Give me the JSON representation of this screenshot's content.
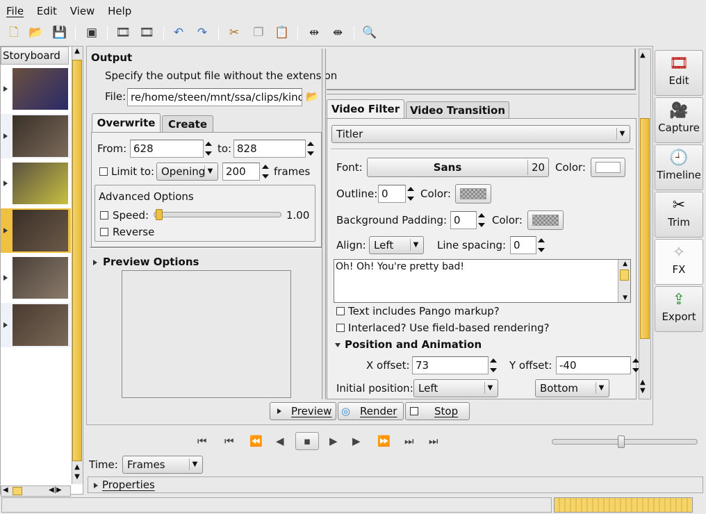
{
  "menu": [
    "File",
    "Edit",
    "View",
    "Help"
  ],
  "toolbar_icons": [
    "new-icon",
    "open-icon",
    "save-icon",
    "save-as-icon",
    "film-icon",
    "film-insert-icon",
    "undo-icon",
    "redo-icon",
    "cut-icon",
    "copy-icon",
    "paste-icon",
    "split-icon",
    "join-icon",
    "zoom-icon"
  ],
  "storyboard": {
    "title": "Storyboard",
    "items": 6,
    "selected": 3
  },
  "output": {
    "title": "Output",
    "description": "Specify the output file without the extension",
    "file_label": "File:",
    "file_value": "re/home/steen/mnt/ssa/clips/kino/",
    "tabs": [
      "Overwrite",
      "Create"
    ],
    "from_label": "From:",
    "from_value": "628",
    "to_label": "to:",
    "to_value": "828",
    "limit_label": "Limit to:",
    "limit_combo": "Opening",
    "limit_value": "200",
    "frames_label": "frames",
    "advanced_title": "Advanced Options",
    "speed_label": "Speed:",
    "speed_value": "1.00",
    "reverse_label": "Reverse",
    "preview_options": "Preview Options"
  },
  "filter": {
    "tabs": [
      "Video Filter",
      "Video Transition"
    ],
    "selected_filter": "Titler",
    "font_label": "Font:",
    "font_name": "Sans",
    "font_size": "20",
    "color_label": "Color:",
    "outline_label": "Outline:",
    "outline_value": "0",
    "bg_padding_label": "Background Padding:",
    "bg_padding_value": "0",
    "align_label": "Align:",
    "align_value": "Left",
    "line_spacing_label": "Line spacing:",
    "line_spacing_value": "0",
    "text": "Oh! Oh! You're pretty bad!",
    "pango_label": "Text includes Pango markup?",
    "interlaced_label": "Interlaced? Use field-based rendering?",
    "position_title": "Position and Animation",
    "x_offset_label": "X offset:",
    "x_offset_value": "73",
    "y_offset_label": "Y offset:",
    "y_offset_value": "-40",
    "initial_position_label": "Initial position:",
    "initial_h": "Left",
    "initial_v": "Bottom"
  },
  "actions": {
    "preview": "Preview",
    "render": "Render",
    "stop": "Stop"
  },
  "modes": [
    "Edit",
    "Capture",
    "Timeline",
    "Trim",
    "FX",
    "Export"
  ],
  "bottom": {
    "time_label": "Time:",
    "time_format": "Frames",
    "properties": "Properties"
  },
  "colors": {
    "accent": "#f5d46a",
    "selected": "#f0c040",
    "panel": "#e9e9e9"
  }
}
